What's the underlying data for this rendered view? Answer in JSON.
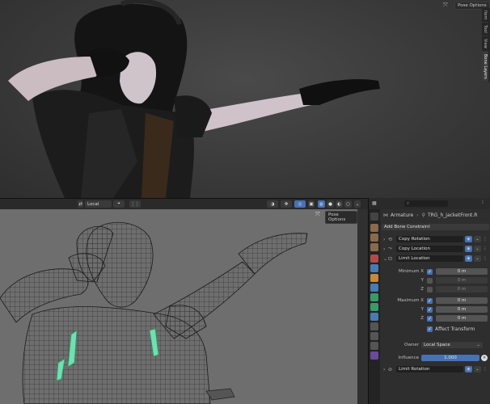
{
  "render_view": {
    "pose_options_label": "Pose Options",
    "side_tabs": [
      "Item",
      "Tool",
      "View",
      "Bone Layers"
    ]
  },
  "lower_header": {
    "transform_orientation": "Local"
  },
  "wire_view": {
    "pose_options_label": "Pose Options"
  },
  "props": {
    "breadcrumb": {
      "armature": "Armature",
      "bone": "TRG_h_jacketFront.R"
    },
    "add_constraint_label": "Add Bone Constraint",
    "constraints": [
      {
        "name": "Copy Rotation",
        "expanded": false
      },
      {
        "name": "Copy Location",
        "expanded": false
      },
      {
        "name": "Limit Location",
        "expanded": true
      }
    ],
    "limit_location": {
      "min_x_label": "Minimum X",
      "min_x": "0 m",
      "y_label": "Y",
      "min_y": "0 m",
      "z_label": "Z",
      "min_z": "0 m",
      "max_x_label": "Maximum X",
      "max_x": "0 m",
      "max_y": "0 m",
      "max_z": "0 m",
      "affect_transform_label": "Affect Transform",
      "owner_label": "Owner",
      "owner_value": "Local Space",
      "influence_label": "Influence",
      "influence_value": "1.000"
    },
    "last_constraint": "Limit Rotation"
  },
  "colors": {
    "accent": "#4772b3",
    "viewport_wire_bg": "#6e6e6e",
    "bone_highlight": "#6fe0b0"
  }
}
